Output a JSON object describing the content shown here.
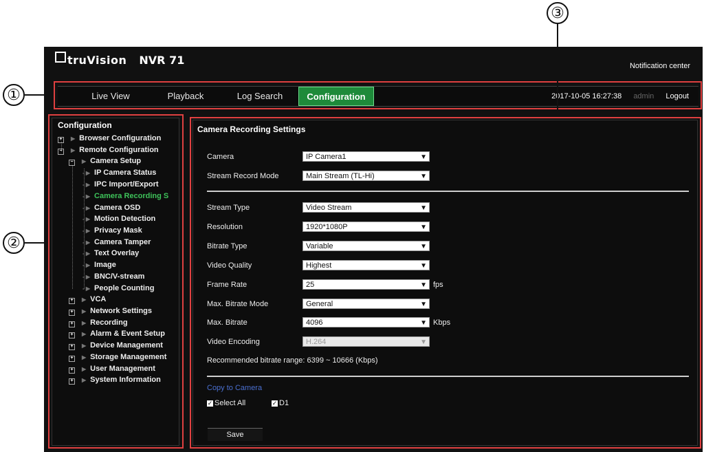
{
  "callouts": [
    "①",
    "②",
    "③"
  ],
  "header": {
    "brand": "truVision",
    "model": "NVR 71",
    "notification": "Notification center"
  },
  "nav": {
    "items": [
      "Live View",
      "Playback",
      "Log Search",
      "Configuration"
    ],
    "active": "Configuration",
    "datetime": "2017-10-05 16:27:38",
    "user": "admin",
    "logout": "Logout"
  },
  "sidebar": {
    "title": "Configuration",
    "items": [
      "Browser Configuration",
      "Remote Configuration",
      "Camera Setup",
      "IP Camera Status",
      "IPC Import/Export",
      "Camera Recording S",
      "Camera OSD",
      "Motion Detection",
      "Privacy Mask",
      "Camera Tamper",
      "Text Overlay",
      "Image",
      "BNC/V-stream",
      "People Counting",
      "VCA",
      "Network Settings",
      "Recording",
      "Alarm & Event Setup",
      "Device Management",
      "Storage Management",
      "User Management",
      "System Information"
    ],
    "active": "Camera Recording S"
  },
  "main": {
    "title": "Camera Recording Settings",
    "fields": [
      {
        "label": "Camera",
        "value": "IP Camera1",
        "unit": ""
      },
      {
        "label": "Stream Record Mode",
        "value": "Main Stream (TL-Hi)",
        "unit": ""
      },
      {
        "label": "Stream Type",
        "value": "Video Stream",
        "unit": ""
      },
      {
        "label": "Resolution",
        "value": "1920*1080P",
        "unit": ""
      },
      {
        "label": "Bitrate Type",
        "value": "Variable",
        "unit": ""
      },
      {
        "label": "Video Quality",
        "value": "Highest",
        "unit": ""
      },
      {
        "label": "Frame Rate",
        "value": "25",
        "unit": "fps"
      },
      {
        "label": "Max. Bitrate Mode",
        "value": "General",
        "unit": ""
      },
      {
        "label": "Max. Bitrate",
        "value": "4096",
        "unit": "Kbps"
      },
      {
        "label": "Video Encoding",
        "value": "H.264",
        "unit": ""
      }
    ],
    "recommended": "Recommended bitrate range: 6399 ~ 10666 (Kbps)",
    "copy_label": "Copy to Camera",
    "select_all": "Select All",
    "d1": "D1",
    "save": "Save"
  },
  "colors": {
    "accent": "#1e8a3a",
    "active_text": "#3ec35a",
    "copy_link": "#4a6fd0",
    "callout_box": "#e04040"
  }
}
